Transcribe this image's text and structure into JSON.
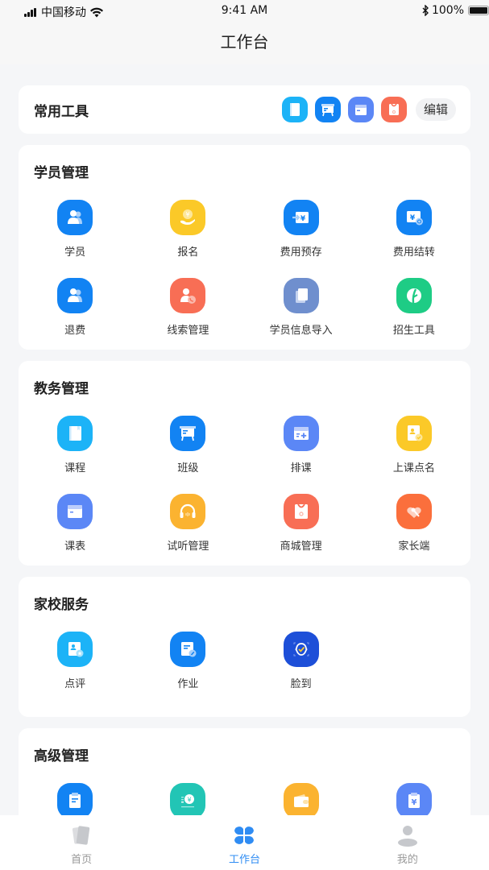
{
  "status_bar": {
    "carrier": "中国移动",
    "time": "9:41 AM",
    "battery": "100%"
  },
  "nav": {
    "title": "工作台"
  },
  "quick_tools": {
    "title": "常用工具",
    "icons": [
      {
        "name": "course-book-icon",
        "color": "#1cb3f7"
      },
      {
        "name": "class-board-icon",
        "color": "#1283f3"
      },
      {
        "name": "schedule-calendar-icon",
        "color": "#5b87f6"
      },
      {
        "name": "mall-bag-icon",
        "color": "#f86e55"
      }
    ],
    "edit_label": "编辑"
  },
  "sections": [
    {
      "title": "学员管理",
      "items": [
        {
          "label": "学员",
          "icon": "students-icon",
          "color": "#1283f3"
        },
        {
          "label": "报名",
          "icon": "enroll-icon",
          "color": "#fbc928"
        },
        {
          "label": "费用预存",
          "icon": "fee-deposit-icon",
          "color": "#1283f3"
        },
        {
          "label": "费用结转",
          "icon": "fee-transfer-icon",
          "color": "#1283f3"
        },
        {
          "label": "退费",
          "icon": "refund-icon",
          "color": "#1283f3"
        },
        {
          "label": "线索管理",
          "icon": "leads-icon",
          "color": "#f86e55"
        },
        {
          "label": "学员信息导入",
          "icon": "import-icon",
          "color": "#6f8fce"
        },
        {
          "label": "招生工具",
          "icon": "recruit-tool-icon",
          "color": "#1ecc85"
        }
      ]
    },
    {
      "title": "教务管理",
      "items": [
        {
          "label": "课程",
          "icon": "course-icon",
          "color": "#1cb3f7"
        },
        {
          "label": "班级",
          "icon": "class-icon",
          "color": "#1283f3"
        },
        {
          "label": "排课",
          "icon": "arrange-course-icon",
          "color": "#5b87f6"
        },
        {
          "label": "上课点名",
          "icon": "roll-call-icon",
          "color": "#fbc928"
        },
        {
          "label": "课表",
          "icon": "timetable-icon",
          "color": "#5b87f6"
        },
        {
          "label": "试听管理",
          "icon": "trial-headphones-icon",
          "color": "#fbb330"
        },
        {
          "label": "商城管理",
          "icon": "mall-icon",
          "color": "#f86e55"
        },
        {
          "label": "家长端",
          "icon": "parent-app-icon",
          "color": "#fb6f3c"
        }
      ]
    },
    {
      "title": "家校服务",
      "items": [
        {
          "label": "点评",
          "icon": "review-icon",
          "color": "#1cb3f7"
        },
        {
          "label": "作业",
          "icon": "homework-icon",
          "color": "#1283f3"
        },
        {
          "label": "脸到",
          "icon": "face-checkin-icon",
          "color": "#1d4fd8"
        }
      ]
    },
    {
      "title": "高级管理",
      "items": [
        {
          "label": "",
          "icon": "clipboard-icon",
          "color": "#1283f3"
        },
        {
          "label": "",
          "icon": "finance-icon",
          "color": "#22c5b5"
        },
        {
          "label": "",
          "icon": "wallet-icon",
          "color": "#fbb330"
        },
        {
          "label": "",
          "icon": "bill-icon",
          "color": "#5b87f6"
        }
      ]
    }
  ],
  "tab_bar": {
    "active_color": "#2f8cf3",
    "inactive_color": "#c6c8cc",
    "tabs": [
      {
        "label": "首页",
        "icon": "home-cards-icon",
        "active": false
      },
      {
        "label": "工作台",
        "icon": "workbench-grid-icon",
        "active": true
      },
      {
        "label": "我的",
        "icon": "profile-icon",
        "active": false
      }
    ]
  }
}
